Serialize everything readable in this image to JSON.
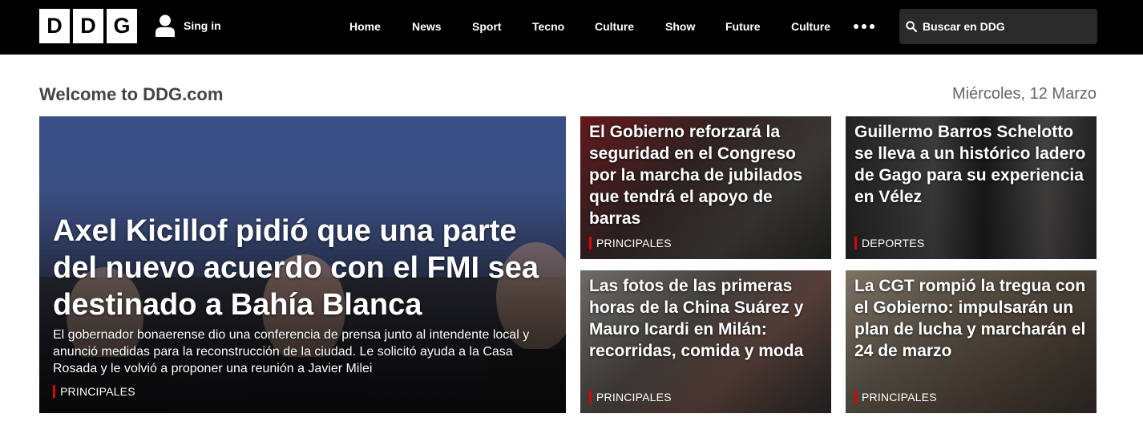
{
  "header": {
    "logo_letters": [
      "D",
      "D",
      "G"
    ],
    "signin_label": "Sing in",
    "nav": [
      "Home",
      "News",
      "Sport",
      "Tecno",
      "Culture",
      "Show",
      "Future",
      "Culture"
    ],
    "search_placeholder": "Buscar en DDG"
  },
  "welcome": {
    "title": "Welcome to DDG.com",
    "date": "Miércoles, 12 Marzo"
  },
  "main_story": {
    "title": "Axel Kicillof pidió que una parte del nuevo acuerdo con el FMI sea destinado a Bahía Blanca",
    "summary": "El gobernador bonaerense dio una conferencia de prensa junto al intendente local y anunció medidas para la reconstrucción de la ciudad. Le solicitó ayuda a la Casa Rosada y le volvió a proponer una reunión a Javier Milei",
    "tag": "PRINCIPALES"
  },
  "stories": [
    {
      "title": "El Gobierno reforzará la seguridad en el Congreso por la marcha de jubilados que tendrá el apoyo de barras",
      "tag": "PRINCIPALES"
    },
    {
      "title": "Guillermo Barros Schelotto se lleva a un histórico ladero de Gago para su experiencia en Vélez",
      "tag": "DEPORTES"
    },
    {
      "title": "Las fotos de las primeras horas de la China Suárez y Mauro Icardi en Milán: recorridas, comida y moda",
      "tag": "PRINCIPALES"
    },
    {
      "title": "La CGT rompió la tregua con el Gobierno: impulsarán un plan de lucha y marcharán el 24 de marzo",
      "tag": "PRINCIPALES"
    }
  ],
  "colors": {
    "header_bg": "#000000",
    "accent_tag": "#e00000",
    "search_bg": "#2a2a2a"
  }
}
